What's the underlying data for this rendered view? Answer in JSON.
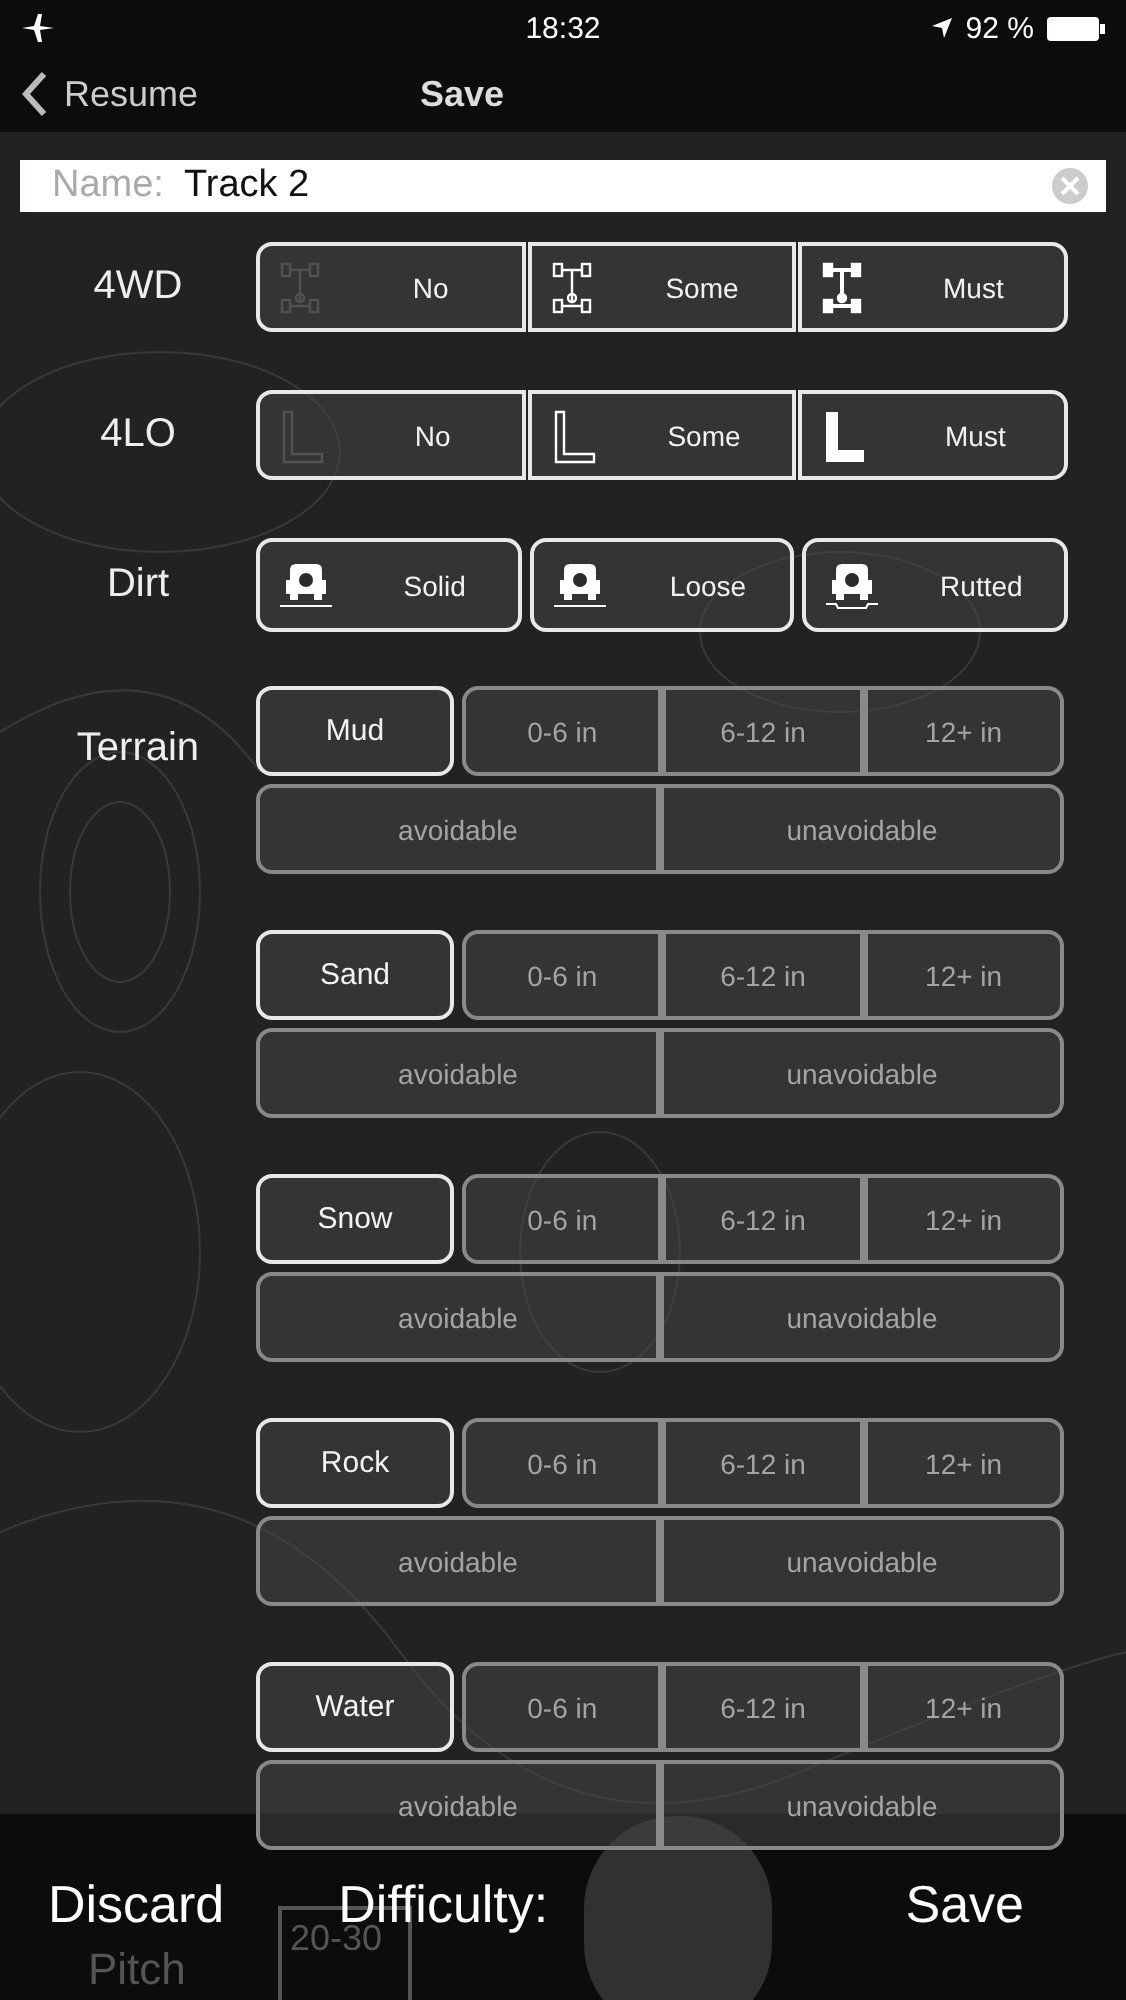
{
  "status_bar": {
    "time": "18:32",
    "battery": "92 %"
  },
  "nav": {
    "back": "Resume",
    "title": "Save"
  },
  "name_field": {
    "label": "Name:",
    "value": "Track 2"
  },
  "options": [
    {
      "label": "4WD",
      "kind": "segmented",
      "choices": [
        {
          "text": "No"
        },
        {
          "text": "Some"
        },
        {
          "text": "Must"
        }
      ]
    },
    {
      "label": "4LO",
      "kind": "segmented",
      "choices": [
        {
          "text": "No"
        },
        {
          "text": "Some"
        },
        {
          "text": "Must"
        }
      ]
    },
    {
      "label": "Dirt",
      "kind": "separate",
      "choices": [
        {
          "text": "Solid"
        },
        {
          "text": "Loose"
        },
        {
          "text": "Rutted"
        }
      ]
    }
  ],
  "terrain": {
    "label": "Terrain",
    "types": [
      {
        "name": "Mud",
        "depths": [
          {
            "text": "0-6 in",
            "disabled": true
          },
          {
            "text": "6-12 in",
            "disabled": true
          },
          {
            "text": "12+ in",
            "disabled": true
          }
        ],
        "avoidance": [
          {
            "text": "avoidable",
            "disabled": true
          },
          {
            "text": "unavoidable",
            "disabled": true
          }
        ]
      },
      {
        "name": "Sand",
        "depths": [
          {
            "text": "0-6 in",
            "disabled": true
          },
          {
            "text": "6-12 in",
            "disabled": true
          },
          {
            "text": "12+ in",
            "disabled": true
          }
        ],
        "avoidance": [
          {
            "text": "avoidable",
            "disabled": true
          },
          {
            "text": "unavoidable",
            "disabled": true
          }
        ]
      },
      {
        "name": "Snow",
        "depths": [
          {
            "text": "0-6 in",
            "disabled": true
          },
          {
            "text": "6-12 in",
            "disabled": true
          },
          {
            "text": "12+ in",
            "disabled": true
          }
        ],
        "avoidance": [
          {
            "text": "avoidable",
            "disabled": true
          },
          {
            "text": "unavoidable",
            "disabled": true
          }
        ]
      },
      {
        "name": "Rock",
        "depths": [
          {
            "text": "0-6 in",
            "disabled": true
          },
          {
            "text": "6-12 in",
            "disabled": true
          },
          {
            "text": "12+ in",
            "disabled": true
          }
        ],
        "avoidance": [
          {
            "text": "avoidable",
            "disabled": true
          },
          {
            "text": "unavoidable",
            "disabled": true
          }
        ]
      },
      {
        "name": "Water",
        "depths": [
          {
            "text": "0-6 in",
            "disabled": true
          },
          {
            "text": "6-12 in",
            "disabled": true
          },
          {
            "text": "12+ in",
            "disabled": true
          }
        ],
        "avoidance": [
          {
            "text": "avoidable",
            "disabled": true
          },
          {
            "text": "unavoidable",
            "disabled": true
          }
        ]
      }
    ]
  },
  "bottom_bar": {
    "discard": "Discard",
    "difficulty": "Difficulty:",
    "save": "Save",
    "behind": {
      "pitch": "Pitch",
      "range": "20-30"
    }
  }
}
